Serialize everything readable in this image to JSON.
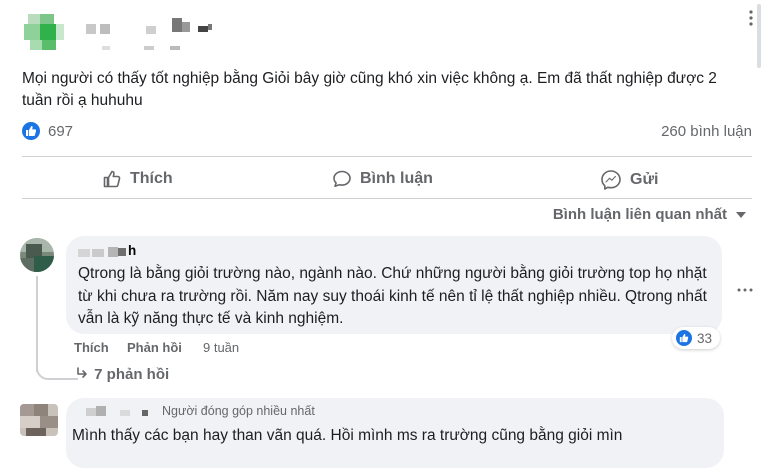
{
  "post": {
    "text": "Mọi người có thấy tốt nghiệp bằng Giỏi bây giờ cũng khó xin việc không ạ. Em đã thất nghiệp được 2 tuần rồi ạ huhuhu",
    "likes": "697",
    "comments": "260 bình luận"
  },
  "actions": {
    "like": "Thích",
    "comment": "Bình luận",
    "share": "Gửi"
  },
  "sort_label": "Bình luận liên quan nhất",
  "comment1": {
    "name_fragment": "h",
    "text": "Qtrong là bằng giỏi trường nào, ngành nào. Chứ những người bằng giỏi trường top họ nhặt từ khi chưa ra trường rồi. Năm nay suy thoái kinh tế nên tỉ lệ thất nghiệp nhiều. Qtrong nhất vẫn là kỹ năng thực tế và kinh nghiệm.",
    "like": "Thích",
    "reply": "Phản hồi",
    "time": "9 tuần",
    "reactions": "33",
    "replies": "7 phản hồi"
  },
  "comment2": {
    "badge": "Người đóng góp nhiều nhất",
    "text": "Mình thấy các bạn hay than vãn quá. Hồi mình ms ra trường cũng bằng giỏi mìn"
  },
  "colors": {
    "accent": "#1b74e4",
    "muted": "#65676b",
    "bubble": "#f0f2f5"
  }
}
